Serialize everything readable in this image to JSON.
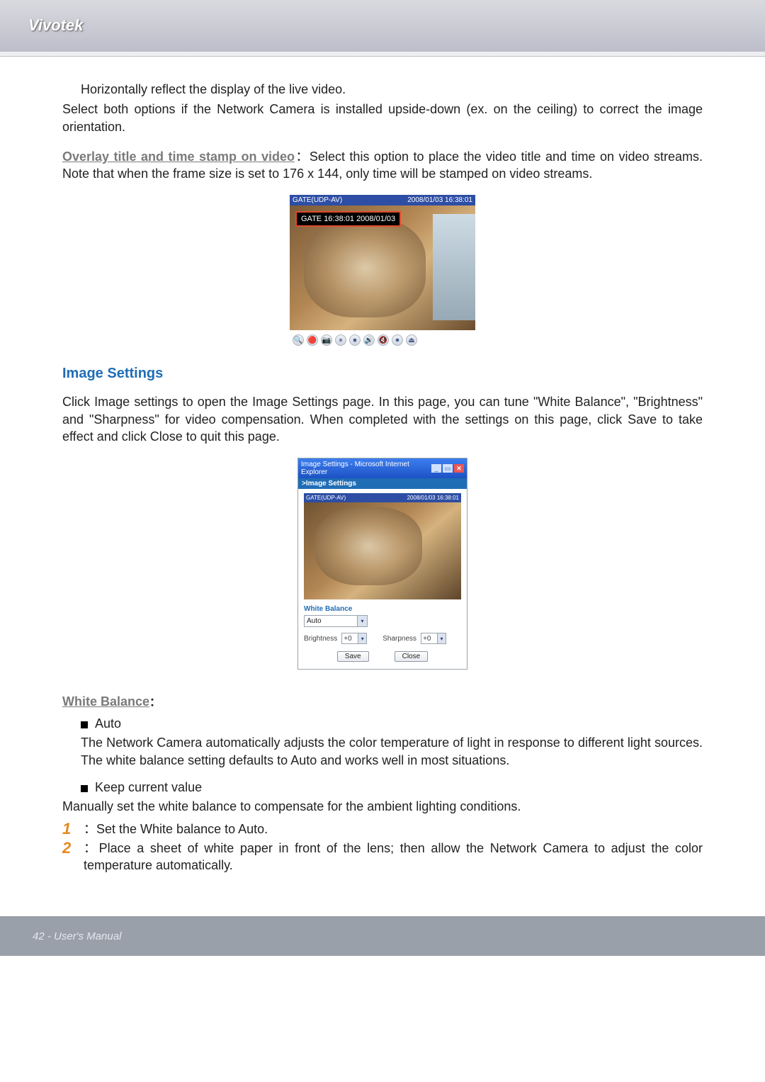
{
  "header": {
    "brand": "Vivotek"
  },
  "intro": {
    "mirror_text": "Horizontally reflect the display of the live video.",
    "both_options": "Select both options if the Network Camera is installed upside-down (ex. on the ceiling) to correct the image orientation.",
    "overlay_label": "Overlay title and time stamp on video",
    "overlay_text": "：Select this option to place the video title and time on video streams. Note that when the frame size is set to 176 x 144, only time will be stamped on video streams."
  },
  "shot1": {
    "bar_left": "GATE(UDP-AV)",
    "bar_right": "2008/01/03 16:38:01",
    "stamp": "GATE 16:38:01 2008/01/03",
    "control_icons": [
      "🔍",
      "🔴",
      "📷",
      "⏸",
      "⏹",
      "🔊",
      "🔇",
      "⏺",
      "⏏"
    ]
  },
  "image_settings": {
    "heading": "Image Settings",
    "desc": "Click Image settings to open the Image Settings page. In this page, you can tune \"White Balance\", \"Brightness\" and \"Sharpness\" for video compensation. When completed with the settings on this page, click Save to take effect and click Close to quit this page."
  },
  "shot2": {
    "window_title": "Image Settings - Microsoft Internet Explorer",
    "crumb": ">Image Settings",
    "preview_bar_left": "GATE(UDP-AV)",
    "preview_bar_right": "2008/01/03 16:38:01",
    "wb_label": "White Balance",
    "wb_value": "Auto",
    "brightness_label": "Brightness",
    "brightness_value": "+0",
    "sharpness_label": "Sharpness",
    "sharpness_value": "+0",
    "save_label": "Save",
    "close_label": "Close"
  },
  "white_balance": {
    "heading": "White Balance",
    "colon": "：",
    "auto_label": "Auto",
    "auto_desc": "The Network Camera automatically adjusts the color temperature of light in response to different light sources. The white balance setting defaults to Auto and works well in most situations.",
    "keep_label": "Keep current value",
    "keep_desc": "Manually set the white balance to compensate for the ambient lighting conditions.",
    "step1": "：Set the White balance to Auto.",
    "step2": "：Place a sheet of white paper in front of the lens; then allow the Network Camera to adjust the color temperature automatically."
  },
  "footer": {
    "text": "42 - User's Manual"
  }
}
